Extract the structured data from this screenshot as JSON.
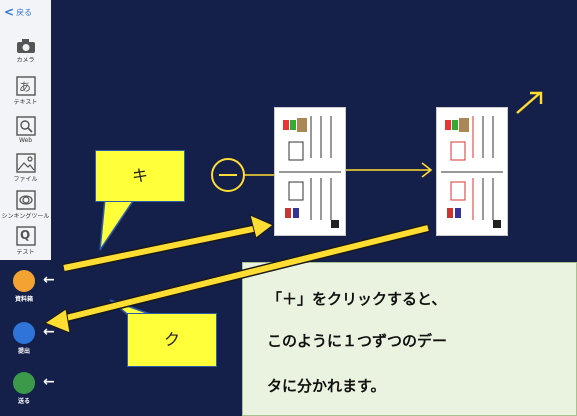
{
  "sidebar": {
    "back_label": "戻る",
    "tools": [
      {
        "label": "カメラ",
        "icon": "camera-icon"
      },
      {
        "label": "テキスト",
        "icon": "text-icon",
        "glyph": "あ"
      },
      {
        "label": "Web",
        "icon": "web-search-icon"
      },
      {
        "label": "ファイル",
        "icon": "file-image-icon"
      },
      {
        "label": "シンキングツール",
        "icon": "thinking-tool-icon"
      },
      {
        "label": "テスト",
        "icon": "test-icon",
        "glyph": "Q"
      }
    ],
    "bottom_buttons": [
      {
        "label": "資料箱",
        "color": "#f2a332"
      },
      {
        "label": "提出",
        "color": "#2f74d8"
      },
      {
        "label": "送る",
        "color": "#3a9a4a"
      }
    ]
  },
  "callouts": {
    "ki": "キ",
    "ku": "ク"
  },
  "note": {
    "lines": [
      "「＋」をクリックすると、",
      "このように１つずつのデー",
      "タに分かれます。"
    ]
  },
  "colors": {
    "background": "#14204a",
    "accent_yellow": "#ffdd33",
    "callout_yellow": "#ffff3a"
  }
}
